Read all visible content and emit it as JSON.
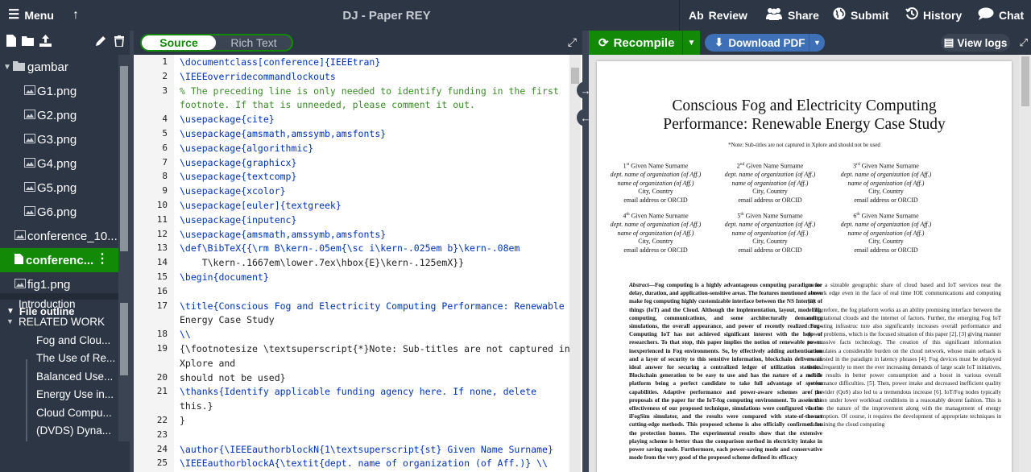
{
  "topbar": {
    "menu_label": "Menu",
    "title": "DJ - Paper REY",
    "review_label": "Review",
    "share_label": "Share",
    "submit_label": "Submit",
    "history_label": "History",
    "chat_label": "Chat"
  },
  "file_tree": {
    "items": [
      {
        "label": "gambar",
        "type": "folder"
      },
      {
        "label": "G1.png",
        "type": "image"
      },
      {
        "label": "G2.png",
        "type": "image"
      },
      {
        "label": "G3.png",
        "type": "image"
      },
      {
        "label": "G4.png",
        "type": "image"
      },
      {
        "label": "G5.png",
        "type": "image"
      },
      {
        "label": "G6.png",
        "type": "image"
      },
      {
        "label": "conference_10...",
        "type": "image"
      },
      {
        "label": "conferenc...",
        "type": "file",
        "selected": true
      },
      {
        "label": "fig1.png",
        "type": "image"
      }
    ]
  },
  "outline": {
    "title": "File outline",
    "items": [
      {
        "label": "Introduction",
        "level": 1
      },
      {
        "label": "RELATED WORK",
        "level": 1
      },
      {
        "label": "Fog and Clou...",
        "level": 2
      },
      {
        "label": "The Use of Re...",
        "level": 2
      },
      {
        "label": "Balanced Use...",
        "level": 2
      },
      {
        "label": "Energy Use in...",
        "level": 2
      },
      {
        "label": "Cloud Compu...",
        "level": 2
      },
      {
        "label": "(DVDS) Dyna...",
        "level": 2
      }
    ]
  },
  "editor": {
    "source_label": "Source",
    "rich_text_label": "Rich Text",
    "line_numbers": [
      "1",
      "2",
      "3",
      "",
      "4",
      "5",
      "6",
      "7",
      "8",
      "9",
      "10",
      "11",
      "12",
      "13",
      "14",
      "15",
      "16",
      "17",
      "",
      "18",
      "19",
      "",
      "20",
      "21",
      "",
      "22",
      "23",
      "24",
      "25"
    ],
    "lines": [
      "\\documentclass[conference]{IEEEtran}",
      "\\IEEEoverridecommandlockouts",
      "% The preceding line is only needed to identify funding in the first",
      "footnote. If that is unneeded, please comment it out.",
      "\\usepackage{cite}",
      "\\usepackage{amsmath,amssymb,amsfonts}",
      "\\usepackage{algorithmic}",
      "\\usepackage{graphicx}",
      "\\usepackage{textcomp}",
      "\\usepackage{xcolor}",
      "\\usepackage[euler]{textgreek}",
      "\\usepackage{inputenc}",
      "\\usepackage{amsmath,amssymb,amsfonts}",
      "\\def\\BibTeX{{\\rm B\\kern-.05em{\\sc i\\kern-.025em b}\\kern-.08em",
      "    T\\kern-.1667em\\lower.7ex\\hbox{E}\\kern-.125emX}}",
      "\\begin{document}",
      "",
      "\\title{Conscious Fog and Electricity Computing Performance: Renewable",
      "Energy Case Study",
      "\\\\",
      "{\\footnotesize \\textsuperscript{*}Note: Sub-titles are not captured in",
      "Xplore and",
      "should not be used}",
      "\\thanks{Identify applicable funding agency here. If none, delete",
      "this.}",
      "}",
      "",
      "\\author{\\IEEEauthorblockN{1\\textsuperscript{st} Given Name Surname}",
      "\\IEEEauthorblockA{\\textit{dept. name of organization (of Aff.)} \\\\"
    ]
  },
  "pdf": {
    "recompile_label": "Recompile",
    "download_label": "Download PDF",
    "view_logs_label": "View logs",
    "title_line1": "Conscious Fog and Electricity Computing",
    "title_line2": "Performance: Renewable Energy Case Study",
    "note": "*Note: Sub-titles are not captured in Xplore and should not be used",
    "authors": [
      {
        "ord": "1",
        "sup": "st",
        "name": " Given Name Surname",
        "dept": "dept. name of organization (of Aff.)",
        "org": "name of organization (of Aff.)",
        "loc": "City, Country",
        "email": "email address or ORCID"
      },
      {
        "ord": "2",
        "sup": "nd",
        "name": " Given Name Surname",
        "dept": "dept. name of organization (of Aff.)",
        "org": "name of organization (of Aff.)",
        "loc": "City, Country",
        "email": "email address or ORCID"
      },
      {
        "ord": "3",
        "sup": "rd",
        "name": " Given Name Surname",
        "dept": "dept. name of organization (of Aff.)",
        "org": "name of organization (of Aff.)",
        "loc": "City, Country",
        "email": "email address or ORCID"
      },
      {
        "ord": "4",
        "sup": "th",
        "name": " Given Name Surname",
        "dept": "dept. name of organization (of Aff.)",
        "org": "name of organization (of Aff.)",
        "loc": "City, Country",
        "email": "email address or ORCID"
      },
      {
        "ord": "5",
        "sup": "th",
        "name": " Given Name Surname",
        "dept": "dept. name of organization (of Aff.)",
        "org": "name of organization (of Aff.)",
        "loc": "City, Country",
        "email": "email address or ORCID"
      },
      {
        "ord": "6",
        "sup": "th",
        "name": " Given Name Surname",
        "dept": "dept. name of organization (of Aff.)",
        "org": "name of organization (of Aff.)",
        "loc": "City, Country",
        "email": "email address or ORCID"
      }
    ],
    "abstract_label": "Abstract",
    "abstract": "—Fog computing is a highly advantageous computing paradigm for delay, duration, and application-sensitive areas. The features mentioned above make fog computing highly customizable interface between the NS Internet of things (IoT) and the Cloud. Although the implementation, layout, modeling, computing, communications, and some architecturally demanding simulations, the overall appearance, and power of recently realized Fog–Computing IoT has not achieved significant interest with the help of researchers. To that stop, this paper implies the notion of renewable power inexperienced in Fog environments. So, by effectively adding authentication and a layer of security to this sensitive information, blockchain delivers an ideal answer for securing a centralized ledger of utilization statistics. Blockchain generation to be easy to use and has the nature of a mobile platform being a perfect candidate to take full advantage of system capabilities. Adaptive performance and power-aware schemes are the proposals of the paper for the IoT-fog computing environment. To assess the effectiveness of our proposed technique, simulations were configured via the iFogSim simulator, and the results were compared with state-of-the-art cutting-edge methods. This proposed scheme is also officially confirmed for the protection homes. The experimental results show that the extensive playing scheme is better than the comparison method in electricity intake in power saving mode. Furthermore, each power-saving mode and conservative mode from the very good of the proposed scheme defined its efficacy",
    "right_col": "create a sizeable geographic share of cloud based and IoT services near the network edge even in the face of real time IOE communications and computing [2].\n    Therefore, the fog platform works as an ability promising interface between the computational clouds and the internet of factors. Further, the emerging Fog IoT computing infrastruc ture also significantly increases overall performance and power problems, which is the focused situation of this paper [2], [3] giving manner to massive facts technology. The creation of this significant information accumulates a considerable burden on the cloud network, whose main setback is manifested in the paradigm in latency phrases [4]. Fog devices must be deployed more frequently to meet the ever increasing demands of large scale IoT initiatives, which results in better power consumption and a boost in various overall performance difficulties. [5]. Then, power intake and decreased inefficient quality of provider (QoS) also led to a tremendous increase [6]. IoT/Fog nodes typically function under lower workload conditions in a reasonably decent fashion. This is due to the nature of the improvement along with the management of energy consumption. Of course, it requires the development of appropriate techniques in maintaining the cloud computing"
  }
}
